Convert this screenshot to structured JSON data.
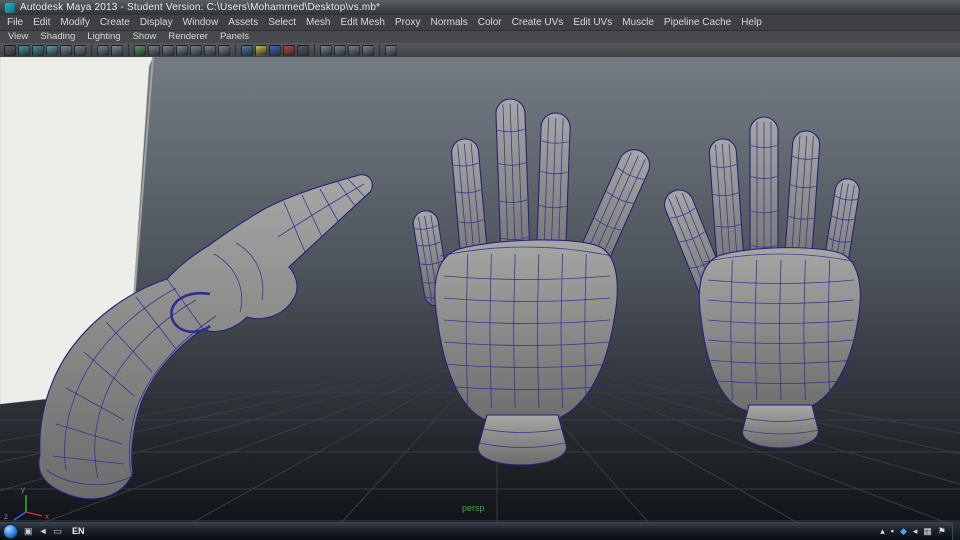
{
  "window": {
    "title": "Autodesk Maya 2013 - Student Version: C:\\Users\\Mohammed\\Desktop\\vs.mb*"
  },
  "menubar": {
    "items": [
      "File",
      "Edit",
      "Modify",
      "Create",
      "Display",
      "Window",
      "Assets",
      "Select",
      "Mesh",
      "Edit Mesh",
      "Proxy",
      "Normals",
      "Color",
      "Create UVs",
      "Edit UVs",
      "Muscle",
      "Pipeline Cache",
      "Help"
    ]
  },
  "panel_menubar": {
    "items": [
      "View",
      "Shading",
      "Lighting",
      "Show",
      "Renderer",
      "Panels"
    ]
  },
  "toolbar": {
    "icons": [
      {
        "name": "menu-collapse-icon",
        "color": "#5a6168"
      },
      {
        "name": "select-camera-icon",
        "color": "#3f98a8"
      },
      {
        "name": "lock-camera-icon",
        "color": "#3f8fa0"
      },
      {
        "name": "camera-attributes-icon",
        "color": "#55a0ae"
      },
      {
        "name": "bookmarks-icon",
        "color": "#7b8690"
      },
      {
        "name": "image-plane-icon",
        "color": "#6f7f8a"
      },
      {
        "sep": true
      },
      {
        "name": "pan-zoom-icon",
        "color": "#74828c"
      },
      {
        "name": "grease-pencil-icon",
        "color": "#7d8a94"
      },
      {
        "sep": true
      },
      {
        "name": "grid-toggle-icon",
        "color": "#5d9a5d"
      },
      {
        "name": "film-gate-icon",
        "color": "#76848e"
      },
      {
        "name": "resolution-gate-icon",
        "color": "#76848e"
      },
      {
        "name": "gate-mask-icon",
        "color": "#76848e"
      },
      {
        "name": "field-chart-icon",
        "color": "#76848e"
      },
      {
        "name": "safe-action-icon",
        "color": "#76848e"
      },
      {
        "name": "safe-title-icon",
        "color": "#76848e"
      },
      {
        "sep": true
      },
      {
        "name": "wireframe-mode-icon",
        "color": "#4a7ab0"
      },
      {
        "name": "shaded-mode-icon",
        "color": "#d8c03a"
      },
      {
        "name": "textured-mode-icon",
        "color": "#3a66c8"
      },
      {
        "name": "lighting-icon",
        "color": "#c04038"
      },
      {
        "name": "shadows-icon",
        "color": "#55585c"
      },
      {
        "sep": true
      },
      {
        "name": "isolate-select-icon",
        "color": "#76848e"
      },
      {
        "name": "xray-icon",
        "color": "#76848e"
      },
      {
        "name": "exposure-icon",
        "color": "#76848e"
      },
      {
        "name": "gamma-icon",
        "color": "#76848e"
      },
      {
        "sep": true
      },
      {
        "name": "share-icon",
        "color": "#76848e"
      }
    ]
  },
  "viewport": {
    "camera_label": "persp",
    "axis": {
      "x": "x",
      "y": "y",
      "z": "z"
    }
  },
  "taskbar": {
    "language_label": "EN",
    "left_icons": [
      {
        "name": "taskbar-app-icon",
        "glyph": "▣",
        "color": "#ccd2d8"
      },
      {
        "name": "volume-icon",
        "glyph": "◄",
        "color": "#ccd2d8"
      },
      {
        "name": "input-settings-icon",
        "glyph": "▭",
        "color": "#ccd2d8"
      }
    ],
    "tray_icons": [
      {
        "name": "chevron-up-icon",
        "glyph": "▴",
        "color": "#d6dbe1"
      },
      {
        "name": "app-tray-icon",
        "glyph": "▪",
        "color": "#d6dbe1"
      },
      {
        "name": "bluetooth-icon",
        "glyph": "◆",
        "color": "#4aa3e8"
      },
      {
        "name": "volume-tray-icon",
        "glyph": "◂",
        "color": "#d6dbe1"
      },
      {
        "name": "network-icon",
        "glyph": "▦",
        "color": "#d6dbe1"
      },
      {
        "name": "action-center-icon",
        "glyph": "⚑",
        "color": "#d6dbe1"
      }
    ]
  }
}
